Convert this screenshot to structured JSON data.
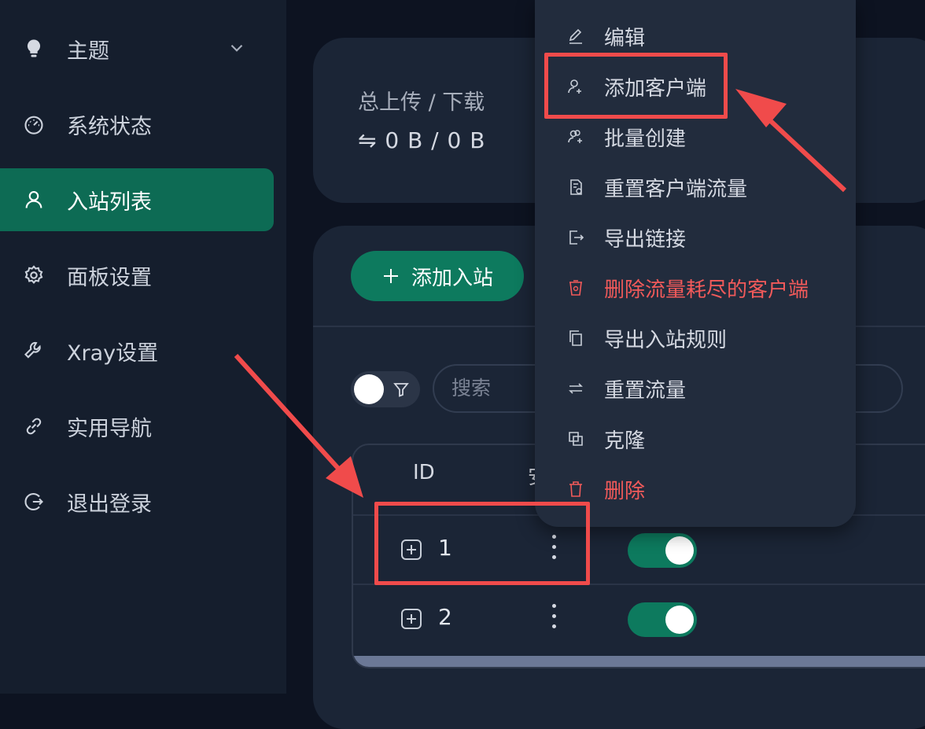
{
  "sidebar": {
    "items": [
      {
        "label": "主题",
        "icon": "bulb-icon",
        "has_chevron": true
      },
      {
        "label": "系统状态",
        "icon": "dashboard-icon"
      },
      {
        "label": "入站列表",
        "icon": "user-icon",
        "active": true
      },
      {
        "label": "面板设置",
        "icon": "gear-icon"
      },
      {
        "label": "Xray设置",
        "icon": "wrench-icon"
      },
      {
        "label": "实用导航",
        "icon": "link-icon"
      },
      {
        "label": "退出登录",
        "icon": "logout-icon"
      }
    ]
  },
  "stats": {
    "label": "总上传 / 下载",
    "value": "⇋ 0 B / 0 B"
  },
  "toolbar": {
    "add_inbound_label": "添加入站",
    "search_placeholder": "搜索"
  },
  "table": {
    "headers": {
      "id": "ID",
      "partial": "安"
    },
    "rows": [
      {
        "id": "1",
        "enabled": true
      },
      {
        "id": "2",
        "enabled": true
      }
    ]
  },
  "context_menu": {
    "items": [
      {
        "label": "编辑",
        "icon": "edit-icon"
      },
      {
        "label": "添加客户端",
        "icon": "user-add-icon"
      },
      {
        "label": "批量创建",
        "icon": "users-add-icon"
      },
      {
        "label": "重置客户端流量",
        "icon": "file-reset-icon"
      },
      {
        "label": "导出链接",
        "icon": "export-icon"
      },
      {
        "label": "删除流量耗尽的客户端",
        "icon": "cup-delete-icon",
        "danger": true
      },
      {
        "label": "导出入站规则",
        "icon": "copy-icon"
      },
      {
        "label": "重置流量",
        "icon": "retweet-icon"
      },
      {
        "label": "克隆",
        "icon": "clone-icon"
      },
      {
        "label": "删除",
        "icon": "trash-icon",
        "danger": true
      }
    ]
  },
  "colors": {
    "accent": "#0d7a5e",
    "active_nav": "#0d6b54",
    "danger": "#f25a5a",
    "annotation": "#f04b4b"
  }
}
